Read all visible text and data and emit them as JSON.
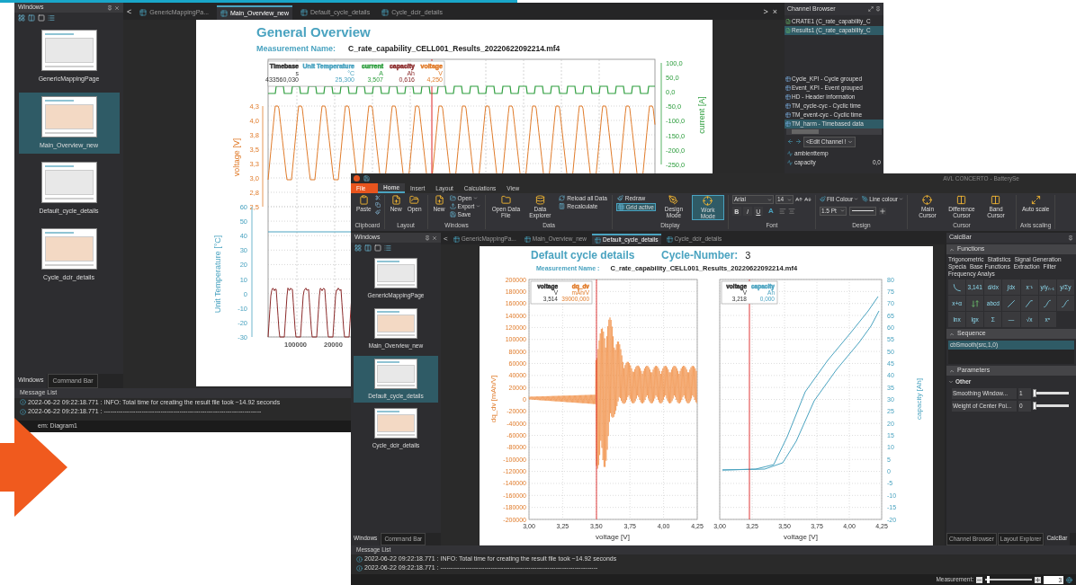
{
  "back_window": {
    "windows_panel": {
      "title": "Windows",
      "items": [
        {
          "label": "GenericMappingPage",
          "selected": false
        },
        {
          "label": "Main_Overview_new",
          "selected": true
        },
        {
          "label": "Default_cycle_details",
          "selected": false
        },
        {
          "label": "Cycle_dcir_details",
          "selected": false
        }
      ],
      "tabs": [
        {
          "label": "Windows",
          "selected": true
        },
        {
          "label": "Command Bar",
          "selected": false
        }
      ]
    },
    "doc_tabs": {
      "prev": "<",
      "items": [
        {
          "label": "GenericMappingPa...",
          "selected": false
        },
        {
          "label": "Main_Overview_new",
          "selected": true
        },
        {
          "label": "Default_cycle_details",
          "selected": false
        },
        {
          "label": "Cycle_dcir_details",
          "selected": false
        }
      ],
      "next": ">",
      "close": "×"
    },
    "page": {
      "title": "General Overview",
      "measurement_label": "Measurement Name:",
      "measurement_value": "C_rate_capability_CELL001_Results_20220622092214.mf4",
      "legend": [
        {
          "name": "Timebase",
          "unit": "s",
          "value": "433560,030",
          "color": "#333333"
        },
        {
          "name": "Unit Temperature",
          "unit": "°C",
          "value": "25,300",
          "color": "#4aa3c0"
        },
        {
          "name": "current",
          "unit": "A",
          "value": "3,507",
          "color": "#2e9e3e"
        },
        {
          "name": "capacity",
          "unit": "Ah",
          "value": "0,616",
          "color": "#8b2a2a"
        },
        {
          "name": "voltage",
          "unit": "V",
          "value": "4,250",
          "color": "#e07b2a"
        }
      ],
      "voltage_axis": {
        "label": "voltage [V]",
        "ticks": [
          "4,3",
          "4,0",
          "3,8",
          "3,5",
          "3,3",
          "3,0",
          "2,8",
          "2,5"
        ]
      },
      "temperature_axis": {
        "label": "Unit Temperature [°C]",
        "ticks": [
          "60",
          "50",
          "40",
          "30",
          "20",
          "10",
          "0",
          "-10",
          "-20",
          "-30"
        ]
      },
      "current_axis": {
        "label": "current [A]",
        "ticks": [
          "100,0",
          "50,0",
          "0,0",
          "-50,0",
          "-100,0",
          "-150,0",
          "-200,0",
          "-250,0"
        ]
      },
      "x_ticks": [
        "100000",
        "20000"
      ]
    },
    "channel_browser": {
      "title": "Channel Browser",
      "files": [
        {
          "label": "CRATE1 (C_rate_capability_C",
          "selected": false
        },
        {
          "label": "Results1 (C_rate_capability_C",
          "selected": true
        }
      ],
      "groups": [
        {
          "label": "Cycle_KPI - Cycle grouped",
          "selected": false
        },
        {
          "label": "Event_KPI - Event grouped",
          "selected": false
        },
        {
          "label": "HD - Header information",
          "selected": false
        },
        {
          "label": "TM_cycle-cyc - Cyclic time",
          "selected": false
        },
        {
          "label": "TM_event-cyc - Cyclic time",
          "selected": false
        },
        {
          "label": "TM_harm - Timebased data",
          "selected": true
        }
      ],
      "channel_select": "<Edit Channel !",
      "channels": [
        {
          "name": "ambienttemp"
        },
        {
          "name": "capacity",
          "value": "0,0"
        }
      ]
    },
    "message_list": {
      "title": "Message List",
      "messages": [
        "2022-06-22 09:22:18.771 : INFO: Total time for creating the result file took ~14.92 seconds",
        "2022-06-22 09:22:18.771 : ---------------------------------------------------------------------------"
      ]
    },
    "status": "em: Diagram1"
  },
  "front_window": {
    "title": "AVL CONCERTO - BatterySe",
    "ribbon_tabs": [
      {
        "label": "File",
        "kind": "file",
        "selected": false
      },
      {
        "label": "Home",
        "kind": "tab",
        "selected": true
      },
      {
        "label": "Insert",
        "kind": "tab",
        "selected": false
      },
      {
        "label": "Layout",
        "kind": "tab",
        "selected": false
      },
      {
        "label": "Calculations",
        "kind": "tab",
        "selected": false
      },
      {
        "label": "View",
        "kind": "tab",
        "selected": false
      }
    ],
    "ribbon_groups": [
      {
        "label": "Clipboard",
        "kind": "buttons",
        "buttons": [
          {
            "kind": "large",
            "label": "Paste"
          },
          {
            "kind": "icon"
          },
          {
            "kind": "icon"
          },
          {
            "kind": "icon"
          }
        ]
      },
      {
        "label": "Layout",
        "kind": "buttons",
        "buttons": [
          {
            "kind": "large",
            "label": "New"
          },
          {
            "kind": "large",
            "label": "Open"
          }
        ]
      },
      {
        "label": "Windows",
        "kind": "buttons",
        "buttons": [
          {
            "kind": "large",
            "label": "New"
          },
          {
            "kind": "small",
            "label": "Open",
            "dropdown": true
          },
          {
            "kind": "small",
            "label": "Export",
            "dropdown": true
          },
          {
            "kind": "small",
            "label": "Save",
            "dropdown": false
          }
        ]
      },
      {
        "label": "Data",
        "kind": "buttons",
        "buttons": [
          {
            "kind": "large",
            "label": "Open Data File"
          },
          {
            "kind": "large",
            "label": "Data Explorer"
          },
          {
            "kind": "small",
            "label": "Reload all Data"
          },
          {
            "kind": "small",
            "label": "Recalculate"
          }
        ]
      },
      {
        "label": "Display",
        "kind": "buttons",
        "buttons": [
          {
            "kind": "small",
            "label": "Redraw",
            "selected": false
          },
          {
            "kind": "small",
            "label": "Grid active",
            "selected": true
          },
          {
            "kind": "large",
            "label": "Design Mode",
            "selected": false
          },
          {
            "kind": "large",
            "label": "Work Mode",
            "selected": true
          }
        ]
      },
      {
        "label": "Font",
        "kind": "font",
        "font": "Arial",
        "size": "14",
        "styles": [
          "B",
          "I",
          "U"
        ],
        "color_button": "A"
      },
      {
        "label": "Design",
        "kind": "design",
        "fill": "Fill Colour",
        "line": "Line colour",
        "width": "1.5 Pt"
      },
      {
        "label": "Cursor",
        "kind": "buttons",
        "buttons": [
          {
            "kind": "large",
            "label": "Main Cursor"
          },
          {
            "kind": "large",
            "label": "Difference Cursor"
          },
          {
            "kind": "large",
            "label": "Band Cursor"
          }
        ]
      },
      {
        "label": "Axis scaling",
        "kind": "buttons",
        "buttons": [
          {
            "kind": "large",
            "label": "Auto scale"
          }
        ]
      }
    ],
    "windows_panel": {
      "title": "Windows",
      "items": [
        {
          "label": "GenericMappingPage",
          "selected": false
        },
        {
          "label": "Main_Overview_new",
          "selected": false
        },
        {
          "label": "Default_cycle_details",
          "selected": true
        },
        {
          "label": "Cycle_dcir_details",
          "selected": false
        }
      ],
      "tabs": [
        {
          "label": "Windows",
          "selected": true
        },
        {
          "label": "Command Bar",
          "selected": false
        }
      ]
    },
    "doc_tabs": {
      "prev": "<",
      "items": [
        {
          "label": "GenericMappingPa...",
          "selected": false
        },
        {
          "label": "Main_Overview_new",
          "selected": false
        },
        {
          "label": "Default_cycle_details",
          "selected": true
        },
        {
          "label": "Cycle_dcir_details",
          "selected": false
        }
      ]
    },
    "page": {
      "title": "Default cycle details",
      "cycle_label": "Cycle-Number:",
      "cycle_value": "3",
      "measurement_label": "Measurement Name :",
      "measurement_value": "C_rate_capability_CELL001_Results_20220622092214.mf4",
      "left_chart": {
        "ylabel": "dq_dv [mAh/V]",
        "xlabel": "voltage [V]",
        "yticks": [
          "200000",
          "180000",
          "160000",
          "140000",
          "120000",
          "100000",
          "80000",
          "60000",
          "40000",
          "20000",
          "0",
          "-20000",
          "-40000",
          "-60000",
          "-80000",
          "-100000",
          "-120000",
          "-140000",
          "-160000",
          "-180000",
          "-200000"
        ],
        "xticks": [
          "3,00",
          "3,25",
          "3,50",
          "3,75",
          "4,00",
          "4,25"
        ],
        "legend": [
          {
            "name": "voltage",
            "unit": "V",
            "value": "3,514",
            "color": "#333333"
          },
          {
            "name": "dq_dv",
            "unit": "mAh/V",
            "value": "39000,000",
            "color": "#e07b2a"
          }
        ]
      },
      "right_chart": {
        "ylabel": "capacity [Ah]",
        "xlabel": "voltage [V]",
        "yticks": [
          "80",
          "75",
          "70",
          "65",
          "60",
          "55",
          "50",
          "45",
          "40",
          "35",
          "30",
          "25",
          "20",
          "15",
          "10",
          "5",
          "0",
          "-5",
          "-10",
          "-15",
          "-20"
        ],
        "xticks": [
          "3,00",
          "3,25",
          "3,50",
          "3,75",
          "4,00",
          "4,25"
        ],
        "legend": [
          {
            "name": "voltage",
            "unit": "V",
            "value": "3,218",
            "color": "#333333"
          },
          {
            "name": "capacity",
            "unit": "Ah",
            "value": "0,000",
            "color": "#4aa3c0"
          }
        ]
      }
    },
    "calcbar": {
      "title": "CalcBar",
      "functions": {
        "title": "Functions",
        "expanded": true,
        "categories": [
          "Trigonometric",
          "Statistics",
          "Signal Generation",
          "Specia",
          "Base Functions",
          "Extraction",
          "Filter",
          "Frequency Analys"
        ],
        "buttons": [
          {
            "kind": "decay"
          },
          {
            "kind": "text",
            "label": "3,141"
          },
          {
            "kind": "text",
            "label": "d/dx"
          },
          {
            "kind": "text",
            "label": "∫dx"
          },
          {
            "kind": "text",
            "label": "x⁻¹"
          },
          {
            "kind": "text",
            "label": "y/yₙ₋₁"
          },
          {
            "kind": "text",
            "label": "y/Σy"
          },
          {
            "kind": "text",
            "label": "x+α"
          },
          {
            "kind": "swap"
          },
          {
            "kind": "text",
            "label": "abcd"
          },
          {
            "kind": "line"
          },
          {
            "kind": "ramp"
          },
          {
            "kind": "scurve"
          },
          {
            "kind": "scurve"
          },
          {
            "kind": "text",
            "label": "lnx"
          },
          {
            "kind": "text",
            "label": "lgx"
          },
          {
            "kind": "text",
            "label": "Σ"
          },
          {
            "kind": "text",
            "label": "—"
          },
          {
            "kind": "text",
            "label": "√x"
          },
          {
            "kind": "text",
            "label": "xⁿ"
          }
        ]
      },
      "sequence": {
        "title": "Sequence",
        "expanded": true,
        "items": [
          {
            "label": "cbSmooth(src,1,0)",
            "selected": true
          }
        ]
      },
      "parameters": {
        "title": "Parameters",
        "expanded": true,
        "group": "Other",
        "rows": [
          {
            "name": "Smoothing Window...",
            "value": "1",
            "level": 0
          },
          {
            "name": "Weight of Center Poi...",
            "value": "0",
            "level": 0
          }
        ]
      },
      "tabs": [
        {
          "label": "Channel Browser",
          "selected": false
        },
        {
          "label": "Layout Explorer",
          "selected": false
        },
        {
          "label": "CalcBar",
          "selected": true
        }
      ]
    },
    "message_list": {
      "title": "Message List",
      "messages": [
        "2022-06-22 09:22:18.771 : INFO: Total time for creating the result file took ~14.92 seconds",
        "2022-06-22 09:22:18.771 : ---------------------------------------------------------------------------"
      ]
    },
    "status_bar": {
      "label": "Measurement:",
      "level": 0.05,
      "value": "3"
    }
  }
}
